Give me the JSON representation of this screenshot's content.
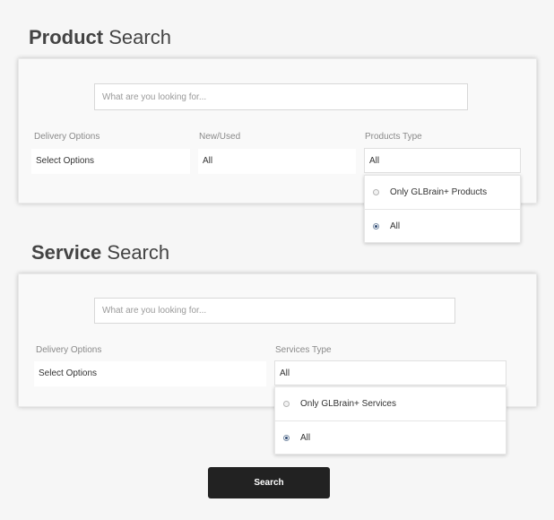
{
  "product_search": {
    "title_bold": "Product",
    "title_rest": " Search",
    "search_placeholder": "What are you looking for...",
    "delivery": {
      "label": "Delivery Options",
      "value": "Select Options"
    },
    "condition": {
      "label": "New/Used",
      "value": "All"
    },
    "type": {
      "label": "Products Type",
      "value": "All",
      "options": [
        {
          "label": "Only GLBrain+ Products",
          "checked": false
        },
        {
          "label": "All",
          "checked": true
        }
      ]
    }
  },
  "service_search": {
    "title_bold": "Service",
    "title_rest": " Search",
    "search_placeholder": "What are you looking for...",
    "delivery": {
      "label": "Delivery Options",
      "value": "Select Options"
    },
    "type": {
      "label": "Services Type",
      "value": "All",
      "options": [
        {
          "label": "Only GLBrain+ Services",
          "checked": false
        },
        {
          "label": "All",
          "checked": true
        }
      ]
    }
  },
  "search_button_label": "Search"
}
